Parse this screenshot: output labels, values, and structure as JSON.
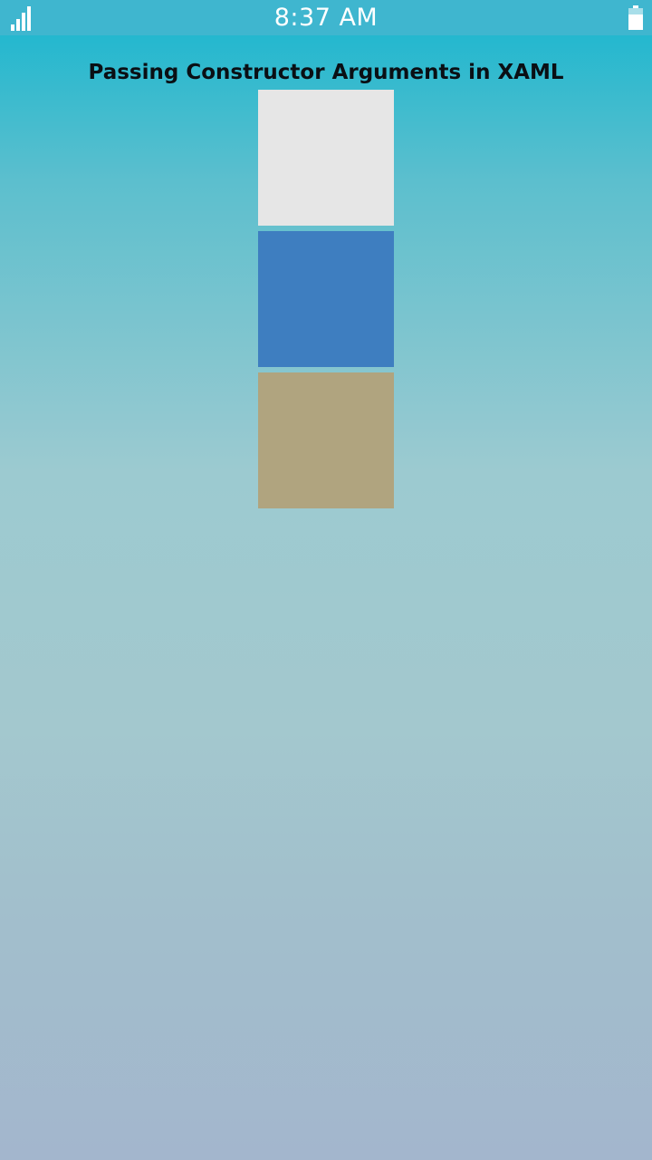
{
  "status_bar": {
    "time": "8:37 AM",
    "signal_icon": "signal-strength-icon",
    "battery_icon": "battery-icon",
    "battery_level": 0.7
  },
  "page": {
    "title": "Passing Constructor Arguments in XAML"
  },
  "colors": {
    "status_bar_bg": "#3fb6cf",
    "background_top": "#16b6cf",
    "background_bottom": "#a3b6cd",
    "title_text": "#0a0f14"
  },
  "boxviews": [
    {
      "color": "#e6e6e6"
    },
    {
      "color": "#3e7ec0"
    },
    {
      "color": "#b0a47f"
    }
  ]
}
